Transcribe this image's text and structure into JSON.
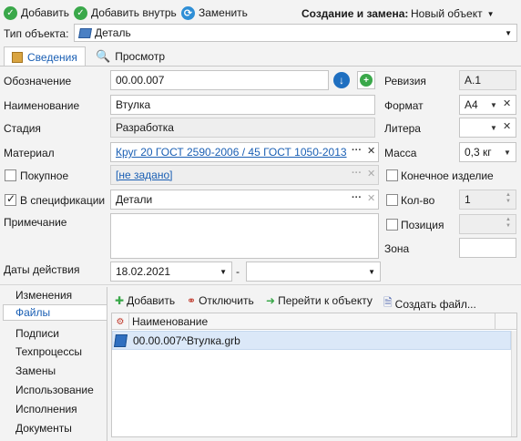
{
  "toolbar": {
    "add": "Добавить",
    "add_inside": "Добавить внутрь",
    "replace": "Заменить",
    "mode_label": "Создание и замена:",
    "mode_value": "Новый объект"
  },
  "object_type": {
    "label": "Тип объекта:",
    "value": "Деталь"
  },
  "tabs": {
    "info": "Сведения",
    "view": "Просмотр"
  },
  "fields": {
    "designation_label": "Обозначение",
    "designation_value": "00.00.007",
    "name_label": "Наименование",
    "name_value": "Втулка",
    "stage_label": "Стадия",
    "stage_value": "Разработка",
    "material_label": "Материал",
    "material_value": "Круг 20 ГОСТ 2590-2006 / 45 ГОСТ 1050-2013",
    "purchased_label": "Покупное",
    "purchased_value": "[не задано]",
    "in_spec_label": "В спецификации",
    "in_spec_value": "Детали",
    "note_label": "Примечание",
    "dates_label": "Даты действия",
    "date_from": "18.02.2021",
    "date_sep": "-",
    "date_to": ""
  },
  "right_fields": {
    "revision_label": "Ревизия",
    "revision_value": "А.1",
    "format_label": "Формат",
    "format_value": "А4",
    "litera_label": "Литера",
    "litera_value": "",
    "mass_label": "Масса",
    "mass_value": "0,3 кг",
    "final_product_label": "Конечное изделие",
    "qty_label": "Кол-во",
    "qty_value": "1",
    "position_label": "Позиция",
    "position_value": "",
    "zone_label": "Зона",
    "zone_value": ""
  },
  "side_tabs": {
    "changes": "Изменения",
    "files": "Файлы",
    "signatures": "Подписи",
    "techprocesses": "Техпроцессы",
    "replacements": "Замены",
    "usage": "Использование",
    "executions": "Исполнения",
    "documents": "Документы"
  },
  "files_toolbar": {
    "add": "Добавить",
    "detach": "Отключить",
    "goto": "Перейти к объекту",
    "create": "Создать файл..."
  },
  "files_grid": {
    "column": "Наименование",
    "rows": [
      {
        "name": "00.00.007^Втулка.grb"
      }
    ]
  },
  "colors": {
    "accent": "#1a5fb4",
    "selection": "#dbe8f8",
    "add_green": "#3aa84a"
  }
}
